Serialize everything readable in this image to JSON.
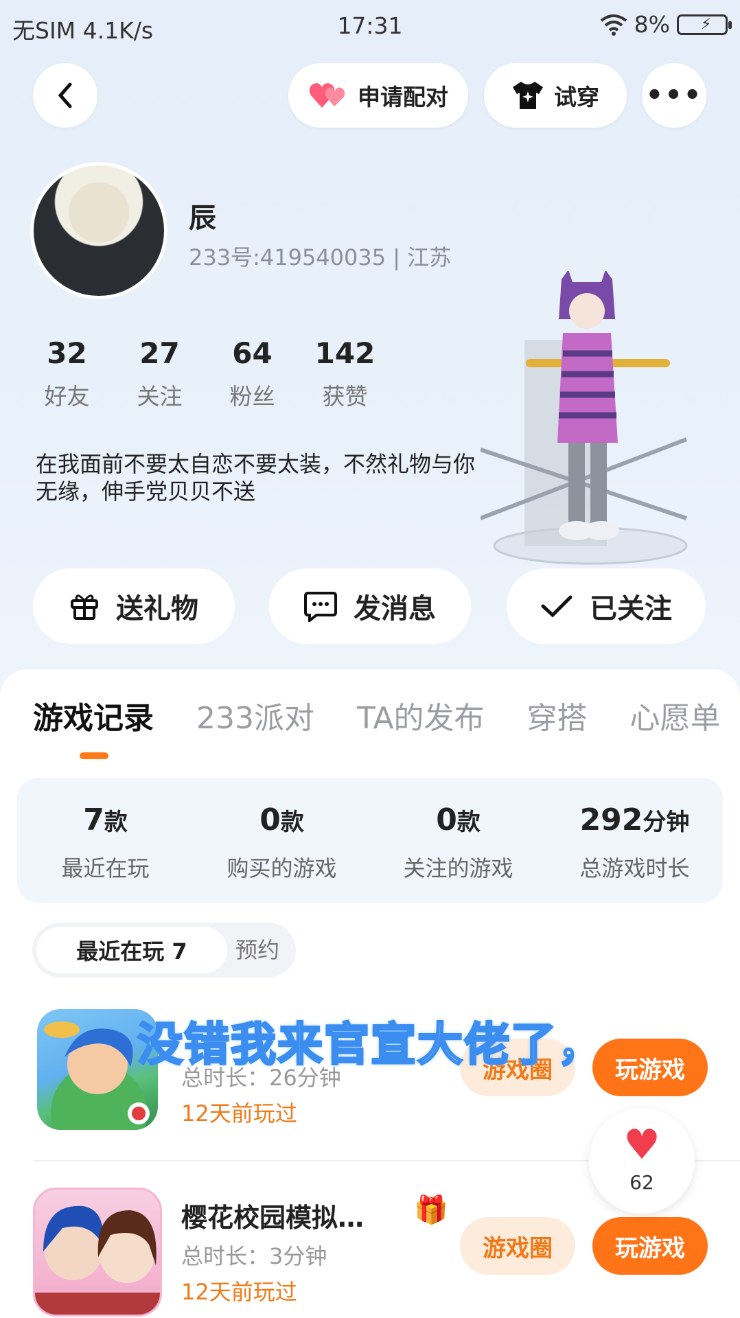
{
  "status": {
    "carrier": "无SIM",
    "speed": "4.1K/s",
    "time": "17:31",
    "battery": "8%",
    "battery_symbol": "⚡"
  },
  "header": {
    "pair_label": "申请配对",
    "try_label": "试穿",
    "more_label": "•••",
    "back_symbol": "‹"
  },
  "profile": {
    "name": "辰",
    "uid": "233号:419540035 | 江苏",
    "bio": "在我面前不要太自恋不要太装，不然礼物与你无缘，伸手党贝贝不送"
  },
  "stats": [
    {
      "n": "32",
      "t": "好友"
    },
    {
      "n": "27",
      "t": "关注"
    },
    {
      "n": "64",
      "t": "粉丝"
    },
    {
      "n": "142",
      "t": "获赞"
    }
  ],
  "actions": {
    "gift": "送礼物",
    "message": "发消息",
    "follow": "已关注"
  },
  "tabs": [
    "游戏记录",
    "233派对",
    "TA的发布",
    "穿搭",
    "心愿单"
  ],
  "summary": [
    {
      "v": "7",
      "u": "款",
      "k": "最近在玩"
    },
    {
      "v": "0",
      "u": "款",
      "k": "购买的游戏"
    },
    {
      "v": "0",
      "u": "款",
      "k": "关注的游戏"
    },
    {
      "v": "292",
      "u": "分钟",
      "k": "总游戏时长"
    }
  ],
  "segment": {
    "on": "最近在玩 7",
    "off": "预约"
  },
  "games": [
    {
      "title": "",
      "time": "总时长：26分钟",
      "ago": "12天前玩过",
      "circle": "游戏圈",
      "play": "玩游戏"
    },
    {
      "title": "樱花校园模拟…",
      "time": "总时长：3分钟",
      "ago": "12天前玩过",
      "circle": "游戏圈",
      "play": "玩游戏"
    }
  ],
  "overlay_caption": "没错我来官宣大佬了，",
  "like_count": "62",
  "colors": {
    "accent": "#ff7416",
    "accent_light": "#fdebdc",
    "caption_stroke": "#3b8df0"
  }
}
